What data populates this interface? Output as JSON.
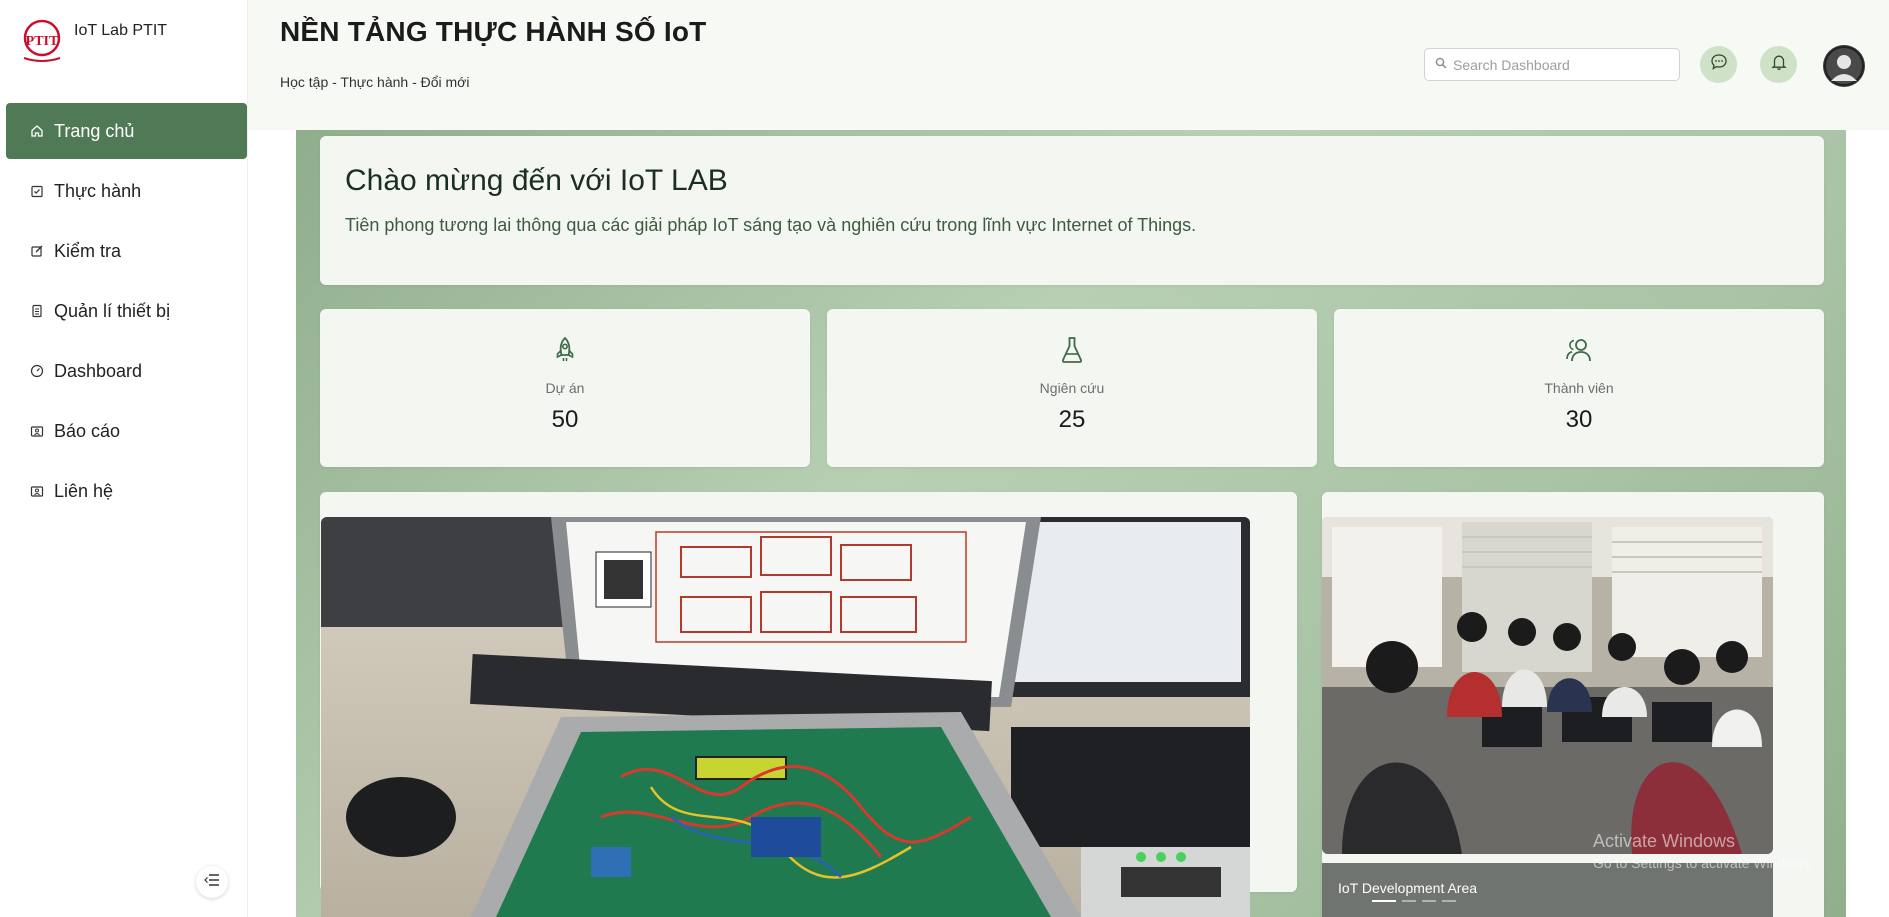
{
  "sidebar": {
    "brand": "IoT Lab PTIT",
    "logo_text": "PTIT",
    "items": [
      {
        "label": "Trang chủ",
        "icon": "home-icon",
        "active": true
      },
      {
        "label": "Thực hành",
        "icon": "clipboard-check-icon"
      },
      {
        "label": "Kiểm tra",
        "icon": "edit-icon"
      },
      {
        "label": "Quản lí thiết bị",
        "icon": "document-icon"
      },
      {
        "label": "Dashboard",
        "icon": "dashboard-gauge-icon"
      },
      {
        "label": "Báo cáo",
        "icon": "report-icon"
      },
      {
        "label": "Liên hệ",
        "icon": "contact-icon"
      }
    ],
    "collapse_icon": "collapse-menu-icon"
  },
  "header": {
    "title": "NỀN TẢNG THỰC HÀNH SỐ IoT",
    "breadcrumb": "Học tập - Thực hành - Đổi mới",
    "search_placeholder": "Search Dashboard",
    "icons": [
      "chat-icon",
      "bell-icon",
      "avatar"
    ]
  },
  "welcome": {
    "title": "Chào mừng đến với IoT LAB",
    "subtitle": "Tiên phong tương lai thông qua các giải pháp IoT sáng tạo và nghiên cứu trong lĩnh vực Internet of Things."
  },
  "stats": [
    {
      "label": "Dự án",
      "value": "50",
      "icon": "rocket-icon"
    },
    {
      "label": "Ngiên cứu",
      "value": "25",
      "icon": "flask-icon"
    },
    {
      "label": "Thành viên",
      "value": "30",
      "icon": "users-icon"
    }
  ],
  "carousel": {
    "caption": "IoT Development Area",
    "slide_count": 4,
    "active_slide": 1
  },
  "watermark": {
    "line1": "Activate Windows",
    "line2": "Go to Settings to activate Windows."
  },
  "colors": {
    "accent": "#4f7a55",
    "panel_green": "#a9c3a5",
    "icon_green": "#3d6b46"
  }
}
